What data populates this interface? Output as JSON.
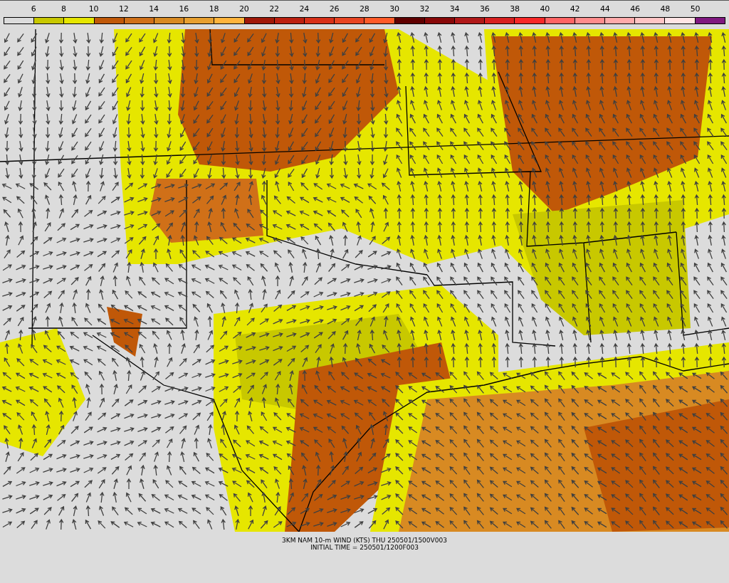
{
  "legend": {
    "ticks": [
      "6",
      "8",
      "10",
      "12",
      "14",
      "16",
      "18",
      "20",
      "22",
      "24",
      "26",
      "28",
      "30",
      "32",
      "34",
      "36",
      "38",
      "40",
      "42",
      "44",
      "46",
      "48",
      "50"
    ],
    "bins": [
      {
        "color": "#dcdcdc"
      },
      {
        "color": "#c8c800"
      },
      {
        "color": "#e6e600"
      },
      {
        "color": "#c05808"
      },
      {
        "color": "#d07018"
      },
      {
        "color": "#d88a22"
      },
      {
        "color": "#e8a030"
      },
      {
        "color": "#ffb43c"
      },
      {
        "color": "#a01808"
      },
      {
        "color": "#bc2010"
      },
      {
        "color": "#d83018"
      },
      {
        "color": "#e84422"
      },
      {
        "color": "#ff5a28"
      },
      {
        "color": "#600000"
      },
      {
        "color": "#880808"
      },
      {
        "color": "#b01818"
      },
      {
        "color": "#d82020"
      },
      {
        "color": "#f82828"
      },
      {
        "color": "#ff6464"
      },
      {
        "color": "#ff8c8c"
      },
      {
        "color": "#ffaaaa"
      },
      {
        "color": "#ffc4c4"
      },
      {
        "color": "#ffe4e4"
      },
      {
        "color": "#801880"
      }
    ]
  },
  "caption": {
    "title": "3KM NAM 10-m WIND (KTS) THU 250501/1500V003",
    "initial_time": "INITIAL TIME = 250501/1200F003"
  }
}
